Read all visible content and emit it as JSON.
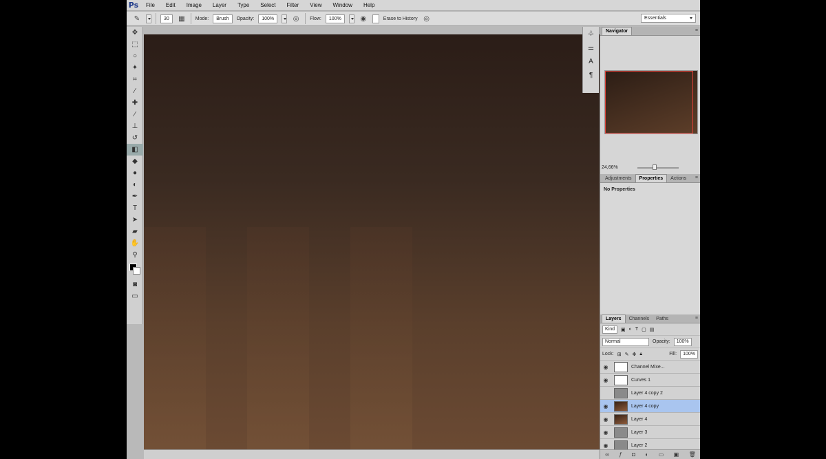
{
  "app": {
    "logo": "Ps"
  },
  "menu": [
    "File",
    "Edit",
    "Image",
    "Layer",
    "Type",
    "Select",
    "Filter",
    "View",
    "Window",
    "Help"
  ],
  "options": {
    "brush_size": "30",
    "mode_label": "Mode:",
    "mode_value": "Brush",
    "opacity_label": "Opacity:",
    "opacity_value": "100%",
    "flow_label": "Flow:",
    "flow_value": "100%",
    "erase_history_label": "Erase to History",
    "workspace": "Essentials"
  },
  "navigator": {
    "title": "Navigator",
    "zoom": "24,66%"
  },
  "properties_panel": {
    "tabs": [
      "Adjustments",
      "Properties",
      "Actions"
    ],
    "active_tab": "Properties",
    "body": "No Properties"
  },
  "layers_panel": {
    "tabs": [
      "Layers",
      "Channels",
      "Paths"
    ],
    "filter": "Kind",
    "blend_mode": "Normal",
    "opacity_label": "Opacity:",
    "opacity_value": "100%",
    "lock_label": "Lock:",
    "fill_label": "Fill:",
    "fill_value": "100%",
    "layers": [
      {
        "name": "Channel Mixe...",
        "thumb": "white",
        "visible": true,
        "selected": false
      },
      {
        "name": "Curves 1",
        "thumb": "white",
        "visible": true,
        "selected": false
      },
      {
        "name": "Layer 4 copy 2",
        "thumb": "gray",
        "visible": false,
        "selected": false
      },
      {
        "name": "Layer 4 copy",
        "thumb": "img",
        "visible": true,
        "selected": true
      },
      {
        "name": "Layer 4",
        "thumb": "img",
        "visible": true,
        "selected": false
      },
      {
        "name": "Layer 3",
        "thumb": "gray",
        "visible": true,
        "selected": false
      },
      {
        "name": "Layer 2",
        "thumb": "gray",
        "visible": true,
        "selected": false
      }
    ]
  },
  "colors": {
    "selection": "#a9c5ef",
    "navigator_frame": "#e0433a",
    "logo": "#1f3a8a"
  }
}
